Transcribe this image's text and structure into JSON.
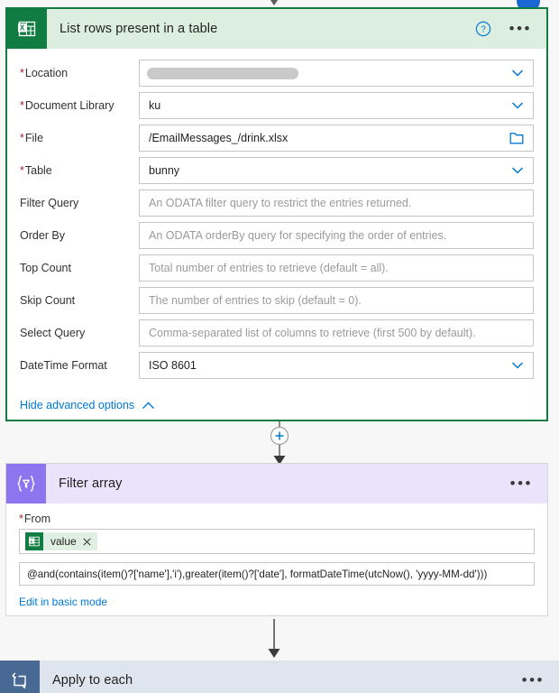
{
  "canvas": {
    "background": "#f7f7f7"
  },
  "colors": {
    "excel_green": "#107c41",
    "excel_header_bg": "#dceedf",
    "filter_purple": "#8b76f0",
    "filter_header_bg": "#e9e3fb",
    "apply_blue": "#486993",
    "apply_header_bg": "#dfe5ee",
    "link_blue": "#0078d4",
    "required_red": "#a4262c",
    "placeholder_gray": "#9a9a9a",
    "blue_dot": "#1967d2"
  },
  "excel_card": {
    "icon": "excel-icon",
    "title": "List rows present in a table",
    "help_icon": "help-circle-icon",
    "menu_icon": "ellipsis-icon",
    "fields": [
      {
        "label": "Location",
        "required": true,
        "value": "",
        "placeholder": "",
        "control": "dropdown",
        "redacted": true
      },
      {
        "label": "Document Library",
        "required": true,
        "value": "ku",
        "placeholder": "",
        "control": "dropdown",
        "redacted": false
      },
      {
        "label": "File",
        "required": true,
        "value": "/EmailMessages_/drink.xlsx",
        "placeholder": "",
        "control": "filepicker",
        "redacted": false
      },
      {
        "label": "Table",
        "required": true,
        "value": "bunny",
        "placeholder": "",
        "control": "dropdown",
        "redacted": false
      },
      {
        "label": "Filter Query",
        "required": false,
        "value": "",
        "placeholder": "An ODATA filter query to restrict the entries returned.",
        "control": "text",
        "redacted": false
      },
      {
        "label": "Order By",
        "required": false,
        "value": "",
        "placeholder": "An ODATA orderBy query for specifying the order of entries.",
        "control": "text",
        "redacted": false
      },
      {
        "label": "Top Count",
        "required": false,
        "value": "",
        "placeholder": "Total number of entries to retrieve (default = all).",
        "control": "text",
        "redacted": false
      },
      {
        "label": "Skip Count",
        "required": false,
        "value": "",
        "placeholder": "The number of entries to skip (default = 0).",
        "control": "text",
        "redacted": false
      },
      {
        "label": "Select Query",
        "required": false,
        "value": "",
        "placeholder": "Comma-separated list of columns to retrieve (first 500 by default).",
        "control": "text",
        "redacted": false
      },
      {
        "label": "DateTime Format",
        "required": false,
        "value": "ISO 8601",
        "placeholder": "",
        "control": "dropdown",
        "redacted": false
      }
    ],
    "advanced_toggle": {
      "label": "Hide advanced options",
      "icon": "chevron-up-icon"
    }
  },
  "connector_add": {
    "icon": "plus-icon"
  },
  "filter_card": {
    "icon": "filter-array-icon",
    "title": "Filter array",
    "menu_icon": "ellipsis-icon",
    "from_label": "From",
    "from_required": true,
    "token": {
      "icon": "excel-icon",
      "label": "value",
      "remove_icon": "close-icon"
    },
    "expression": "@and(contains(item()?['name'],'i'),greater(item()?['date'], formatDateTime(utcNow(), 'yyyy-MM-dd')))",
    "mode_link": "Edit in basic mode"
  },
  "apply_card": {
    "icon": "loop-icon",
    "title": "Apply to each",
    "menu_icon": "ellipsis-icon"
  }
}
